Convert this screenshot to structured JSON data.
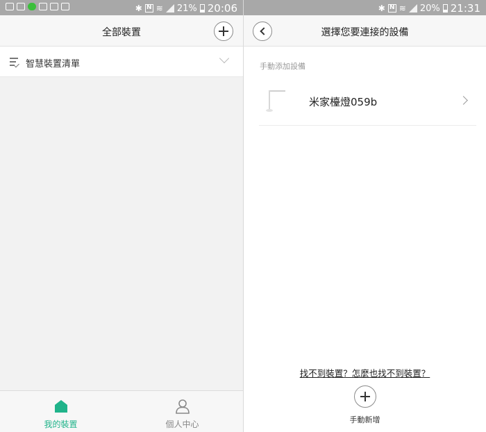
{
  "left": {
    "status": {
      "battery": "21%",
      "time": "20:06"
    },
    "header": {
      "title": "全部裝置"
    },
    "list": {
      "label": "智慧裝置清單"
    },
    "tabs": [
      {
        "label": "我的裝置",
        "icon": "home-icon",
        "active": true,
        "color": "#20b38a"
      },
      {
        "label": "個人中心",
        "icon": "person-icon",
        "active": false,
        "color": "#888888"
      }
    ]
  },
  "right": {
    "status": {
      "battery": "20%",
      "time": "21:31"
    },
    "header": {
      "title": "選擇您要連接的設備"
    },
    "section": {
      "label": "手動添加設備"
    },
    "devices": [
      {
        "name": "米家檯燈059b",
        "icon": "desk-lamp-icon"
      }
    ],
    "help_link": "找不到裝置？怎麼也找不到裝置？",
    "add_label": "手動新增"
  }
}
